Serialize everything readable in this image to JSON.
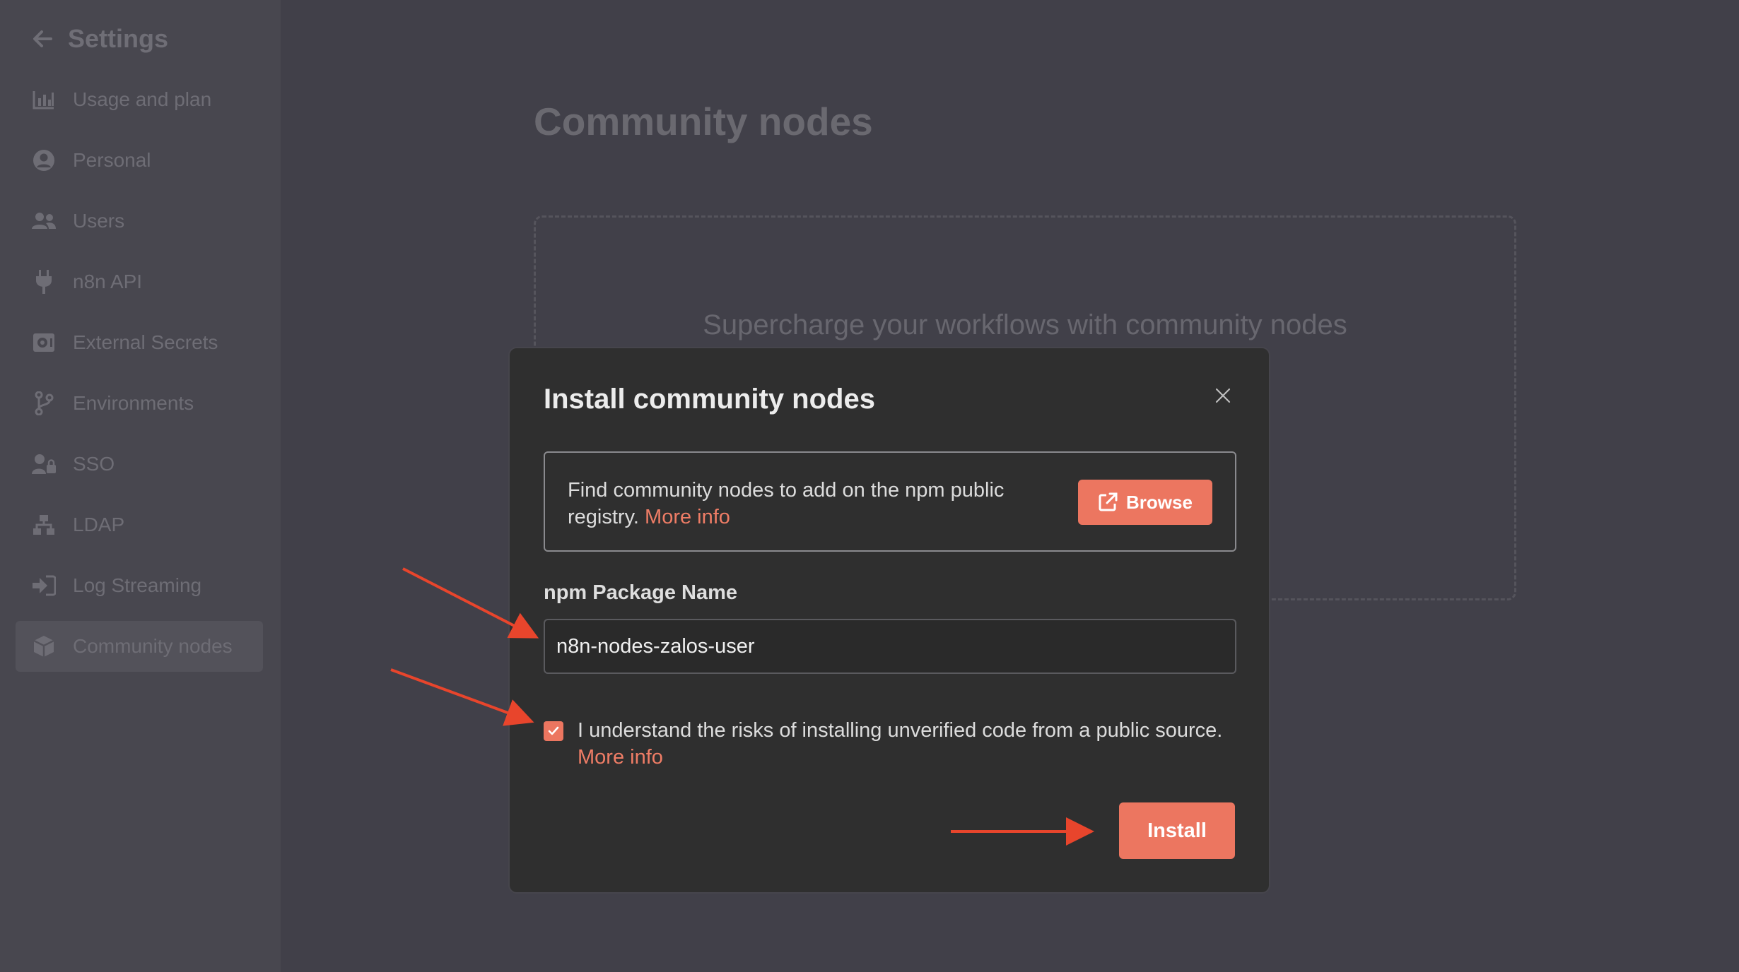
{
  "sidebar": {
    "title": "Settings",
    "items": [
      {
        "label": "Usage and plan",
        "icon": "bar-chart-icon"
      },
      {
        "label": "Personal",
        "icon": "user-circle-icon"
      },
      {
        "label": "Users",
        "icon": "users-icon"
      },
      {
        "label": "n8n API",
        "icon": "plug-icon"
      },
      {
        "label": "External Secrets",
        "icon": "vault-icon"
      },
      {
        "label": "Environments",
        "icon": "git-branch-icon"
      },
      {
        "label": "SSO",
        "icon": "user-lock-icon"
      },
      {
        "label": "LDAP",
        "icon": "network-icon"
      },
      {
        "label": "Log Streaming",
        "icon": "sign-in-icon"
      },
      {
        "label": "Community nodes",
        "icon": "cube-icon",
        "active": true
      }
    ]
  },
  "main": {
    "title": "Community nodes",
    "empty_text": "Supercharge your workflows with community nodes"
  },
  "dialog": {
    "title": "Install community nodes",
    "info_text": "Find community nodes to add on the npm public registry.",
    "info_link": "More info",
    "browse_label": "Browse",
    "field_label": "npm Package Name",
    "package_value": "n8n-nodes-zalos-user",
    "consent_checked": true,
    "consent_text": "I understand the risks of installing unverified code from a public source.",
    "consent_link": "More info",
    "install_label": "Install"
  },
  "colors": {
    "accent": "#ec7660",
    "annotation_arrow": "#e8452c",
    "dialog_bg": "#2f2f2f",
    "page_bg": "#414049"
  }
}
